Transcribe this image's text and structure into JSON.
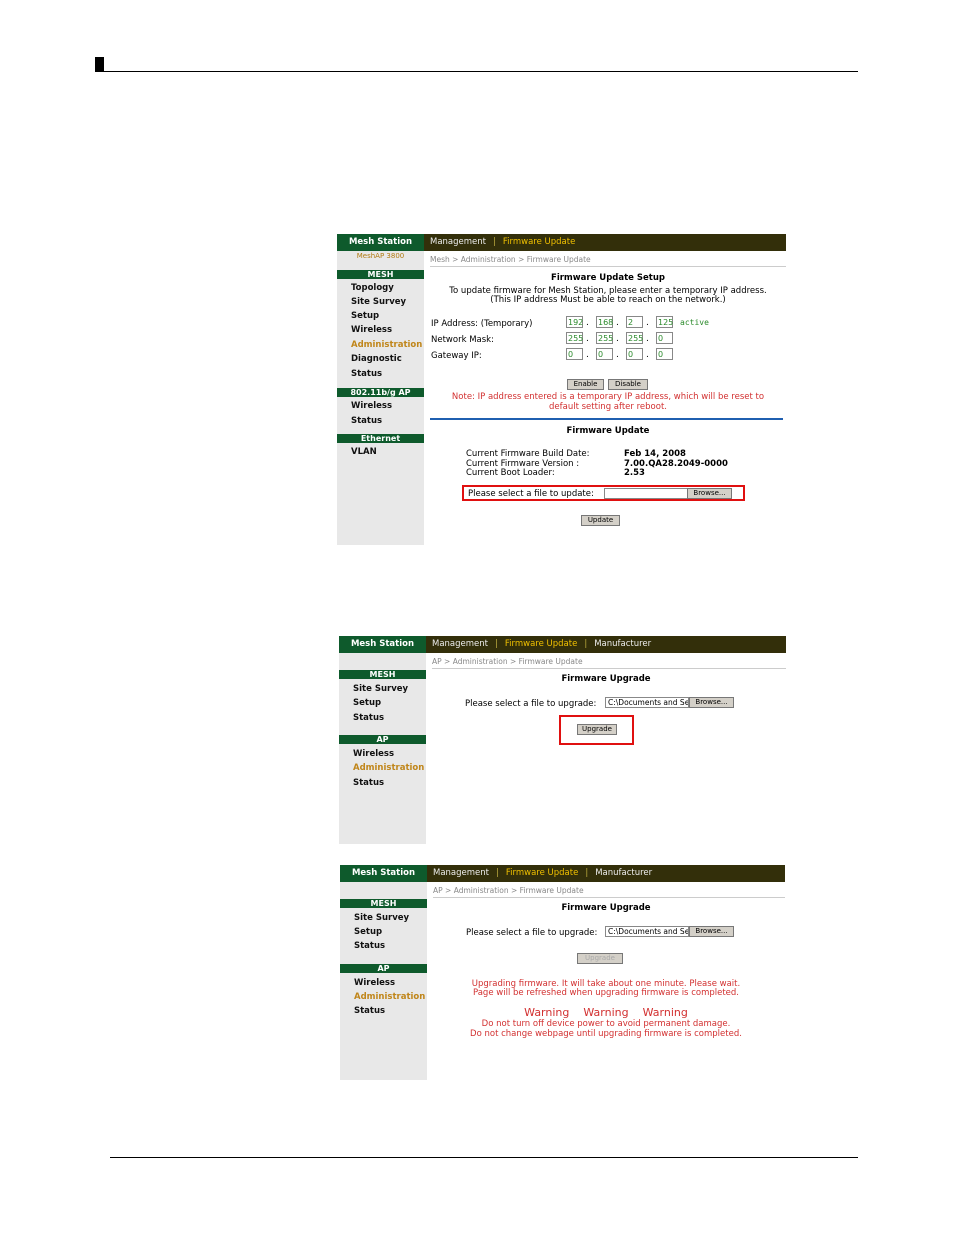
{
  "screen1": {
    "side_title": "Mesh Station",
    "side_sub": "MeshAP 3800",
    "sections": [
      {
        "label": "MESH",
        "items": [
          "Topology",
          "Site Survey",
          "Setup",
          "Wireless",
          "Administration",
          "Diagnostic",
          "Status"
        ]
      },
      {
        "label": "802.11b/g AP",
        "items": [
          "Wireless",
          "Status"
        ]
      },
      {
        "label": "Ethernet",
        "items": [
          "VLAN"
        ]
      }
    ],
    "tabs": [
      "Management",
      "Firmware Update"
    ],
    "breadcrumb": "Mesh > Administration > Firmware Update",
    "setup_title": "Firmware Update Setup",
    "setup_line1": "To update firmware for Mesh Station, please enter a temporary IP address.",
    "setup_line2": "(This IP address Must be able to reach on the network.)",
    "ip_label": "IP Address: (Temporary)",
    "mask_label": "Network Mask:",
    "gw_label": "Gateway IP:",
    "ip": [
      "192",
      "168",
      "2",
      "125"
    ],
    "ip_status": "active",
    "mask": [
      "255",
      "255",
      "255",
      "0"
    ],
    "gw": [
      "0",
      "0",
      "0",
      "0"
    ],
    "enable_label": "Enable",
    "disable_label": "Disable",
    "note1": "Note: IP address entered is a temporary IP address, which will be reset to",
    "note2": "default setting after reboot.",
    "fw_title": "Firmware Update",
    "build_label": "Current Firmware Build Date:",
    "build_value": "Feb 14, 2008",
    "version_label": "Current Firmware Version :",
    "version_value": "7.00.QA28.2049-0000",
    "boot_label": "Current Boot Loader:",
    "boot_value": "2.53",
    "select_label": "Please select a file to update:",
    "browse_label": "Browse...",
    "update_label": "Update"
  },
  "screen2": {
    "side_title": "Mesh Station",
    "sections": [
      {
        "label": "MESH",
        "items": [
          "Site Survey",
          "Setup",
          "Status"
        ]
      },
      {
        "label": "AP",
        "items": [
          "Wireless",
          "Administration",
          "Status"
        ]
      }
    ],
    "tabs": [
      "Management",
      "Firmware Update",
      "Manufacturer"
    ],
    "breadcrumb": "AP > Administration > Firmware Update",
    "title": "Firmware Upgrade",
    "select_label": "Please select a file to upgrade:",
    "file_value": "C:\\Documents and Se",
    "browse_label": "Browse...",
    "upgrade_label": "Upgrade"
  },
  "screen3": {
    "side_title": "Mesh Station",
    "sections": [
      {
        "label": "MESH",
        "items": [
          "Site Survey",
          "Setup",
          "Status"
        ]
      },
      {
        "label": "AP",
        "items": [
          "Wireless",
          "Administration",
          "Status"
        ]
      }
    ],
    "tabs": [
      "Management",
      "Firmware Update",
      "Manufacturer"
    ],
    "breadcrumb": "AP > Administration > Firmware Update",
    "title": "Firmware Upgrade",
    "select_label": "Please select a file to upgrade:",
    "file_value": "C:\\Documents and Se",
    "browse_label": "Browse...",
    "upgrade_label": "Upgrade",
    "msg1": "Upgrading firmware. It will take about one minute. Please wait.",
    "msg2": "Page will be refreshed when upgrading firmware is completed.",
    "warnings": [
      "Warning",
      "Warning",
      "Warning"
    ],
    "warn1": "Do not turn off device power to avoid permanent damage.",
    "warn2": "Do not change webpage until upgrading firmware is completed."
  },
  "colors": {
    "sidebar_green": "#0e5a2c",
    "topbar": "#332f0a",
    "highlight": "#f0c000",
    "warning_red": "#d23030"
  }
}
